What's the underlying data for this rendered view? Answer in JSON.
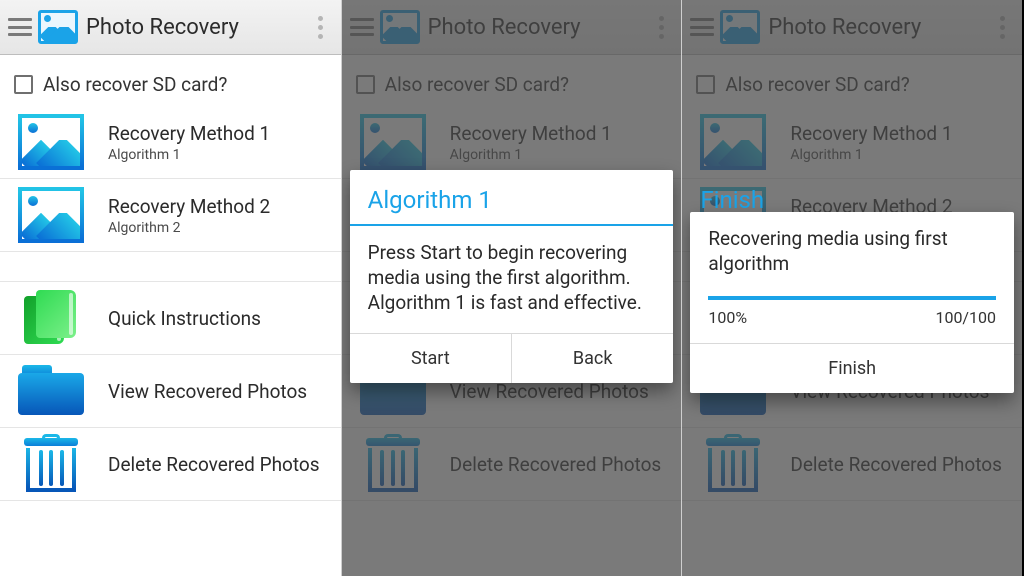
{
  "app": {
    "title": "Photo Recovery"
  },
  "sd": {
    "label": "Also recover SD card?"
  },
  "methods": [
    {
      "title": "Recovery Method 1",
      "subtitle": "Algorithm 1"
    },
    {
      "title": "Recovery Method 2",
      "subtitle": "Algorithm 2"
    }
  ],
  "actions": {
    "instructions": "Quick Instructions",
    "view": "View Recovered Photos",
    "delete": "Delete Recovered Photos"
  },
  "dialog1": {
    "title": "Algorithm 1",
    "body": "Press Start to begin recovering media using the first algorithm. Algorithm 1 is fast and effective.",
    "start": "Start",
    "back": "Back"
  },
  "dialog2": {
    "ghost_title": "Finish",
    "body": "Recovering media using first algorithm",
    "percent_label": "100%",
    "count_label": "100/100",
    "percent_value": 100,
    "finish": "Finish"
  },
  "colors": {
    "accent": "#1aa3e8"
  }
}
